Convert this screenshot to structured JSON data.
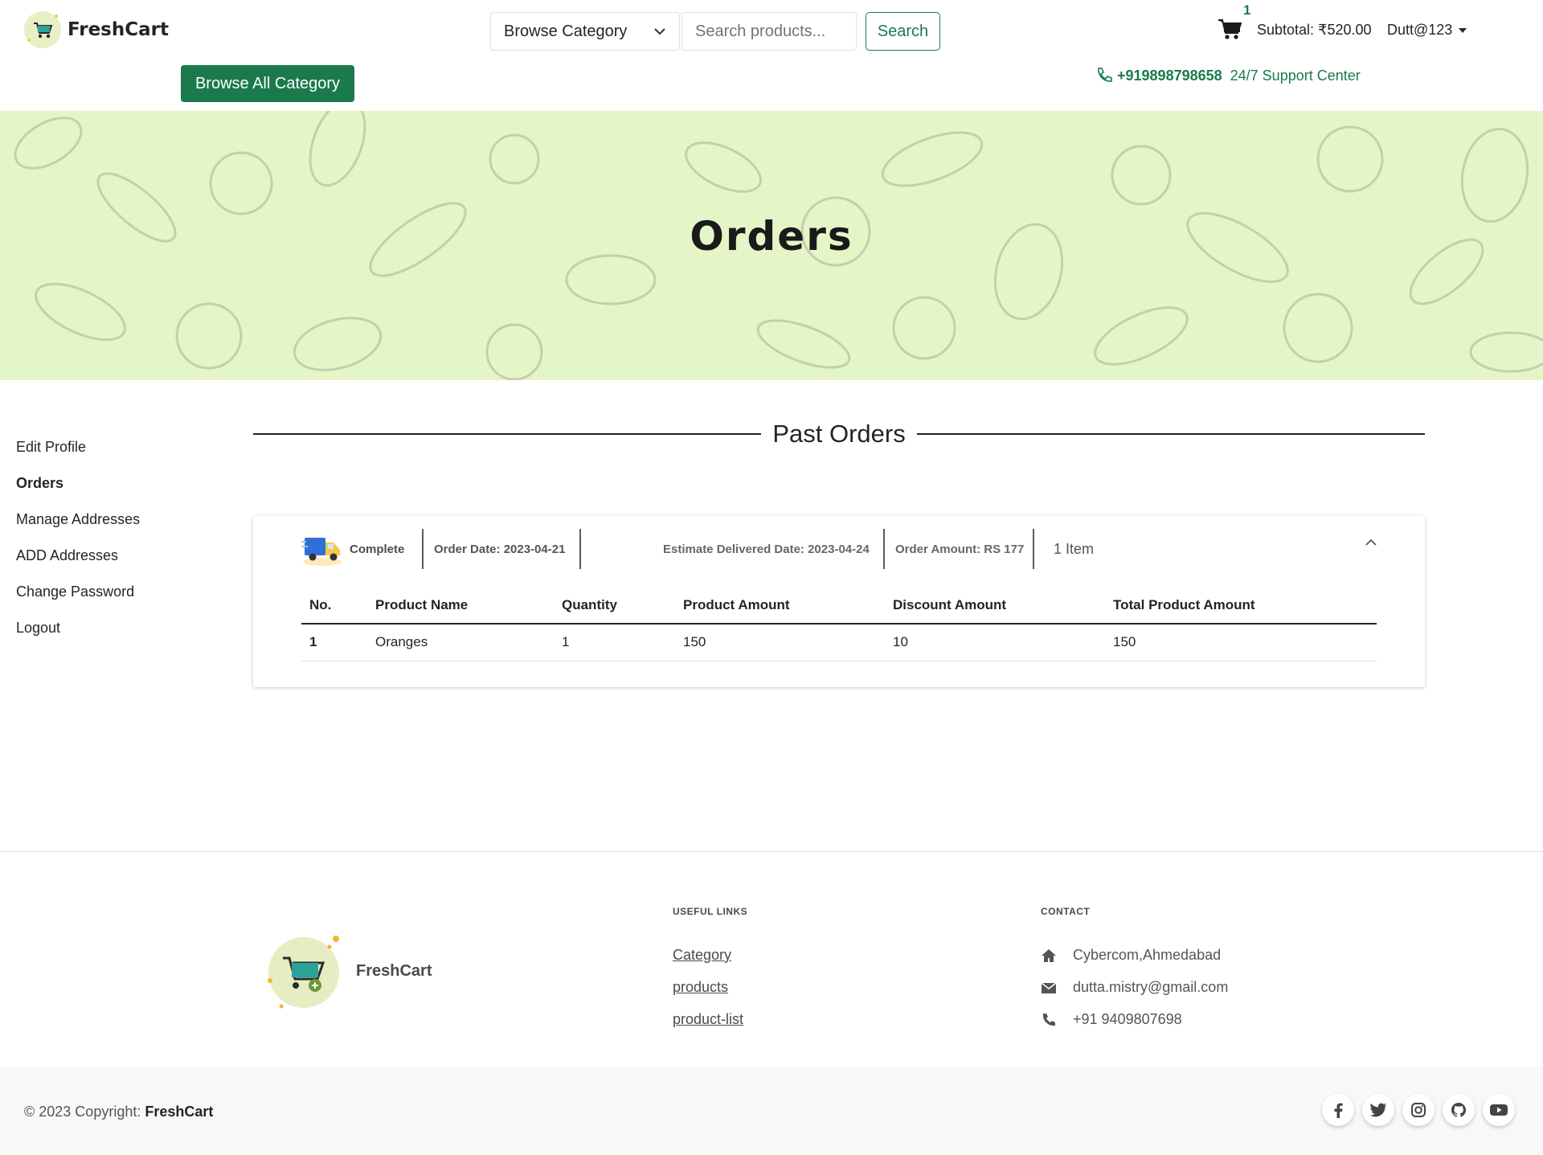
{
  "header": {
    "brand": "FreshCart",
    "category_select": "Browse Category",
    "search_placeholder": "Search products...",
    "search_button": "Search",
    "cart_count": "1",
    "subtotal": "Subtotal: ₹520.00",
    "user": "Dutt@123",
    "browse_all": "Browse All Category",
    "phone": "+919898798658",
    "support": "24/7 Support Center"
  },
  "banner": {
    "title": "Orders"
  },
  "sidebar": {
    "items": [
      {
        "label": "Edit Profile"
      },
      {
        "label": "Orders"
      },
      {
        "label": "Manage Addresses"
      },
      {
        "label": "ADD Addresses"
      },
      {
        "label": "Change Password"
      },
      {
        "label": "Logout"
      }
    ]
  },
  "main": {
    "heading": "Past Orders",
    "order": {
      "status": "Complete",
      "order_date": "Order Date: 2023-04-21",
      "estimate_date": "Estimate Delivered Date: 2023-04-24",
      "order_amount": "Order Amount: RS 177",
      "item_count": "1 Item",
      "columns": [
        "No.",
        "Product Name",
        "Quantity",
        "Product Amount",
        "Discount Amount",
        "Total Product Amount"
      ],
      "rows": [
        {
          "no": "1",
          "name": "Oranges",
          "qty": "1",
          "amount": "150",
          "discount": "10",
          "total": "150"
        }
      ]
    }
  },
  "footer": {
    "brand": "FreshCart",
    "useful_links_title": "USEFUL LINKS",
    "links": [
      "Category",
      "products",
      "product-list"
    ],
    "contact_title": "CONTACT",
    "address": "Cybercom,Ahmedabad",
    "email": "dutta.mistry@gmail.com",
    "phone": "+91 9409807698",
    "copyright_prefix": "© 2023 Copyright:",
    "copyright_brand": "FreshCart"
  },
  "colors": {
    "brand_green": "#1b7a4c",
    "banner_bg": "#e4f5c7"
  },
  "icons": [
    "cart-icon",
    "chevron-down-icon",
    "phone-icon",
    "truck-icon",
    "chevron-up-icon",
    "home-icon",
    "envelope-icon",
    "phone-solid-icon",
    "facebook-icon",
    "twitter-icon",
    "instagram-icon",
    "github-icon",
    "youtube-icon"
  ]
}
